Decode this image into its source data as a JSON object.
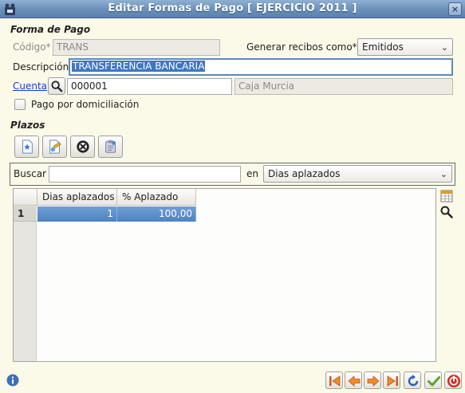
{
  "window": {
    "title": "Editar Formas de Pago [ EJERCICIO 2011 ]",
    "close_glyph": "×"
  },
  "forma_pago": {
    "section_title": "Forma de Pago",
    "codigo_label": "Código*",
    "codigo_value": "TRANS",
    "generar_label": "Generar recibos como*",
    "generar_value": "Emitidos",
    "descripcion_label": "Descripción",
    "descripcion_value": "TRANSFERENCIA BANCARIA",
    "cuenta_label": "Cuenta",
    "cuenta_value": "000001",
    "cuenta_desc": "Caja Murcia",
    "domiciliacion_label": "Pago por domiciliación",
    "domiciliacion_checked": false
  },
  "plazos": {
    "section_title": "Plazos",
    "toolbar_icons": [
      "new-record-icon",
      "edit-record-icon",
      "delete-record-icon",
      "copy-record-icon"
    ],
    "search_label": "Buscar",
    "search_value": "",
    "en_label": "en",
    "search_field": "Dias aplazados",
    "columns": [
      "Dias aplazados",
      "% Aplazado"
    ],
    "rows": [
      {
        "num": "1",
        "dias": "1",
        "pct": "100,00"
      }
    ]
  },
  "footer": {
    "nav_icons": [
      "first-record-icon",
      "previous-record-icon",
      "next-record-icon",
      "last-record-icon",
      "refresh-icon",
      "accept-icon",
      "cancel-icon"
    ]
  },
  "colors": {
    "titlebar": "#6a8fb9",
    "window_bg": "#fbf9e8",
    "selection": "#4d82c3",
    "link": "#1c3ad6"
  }
}
